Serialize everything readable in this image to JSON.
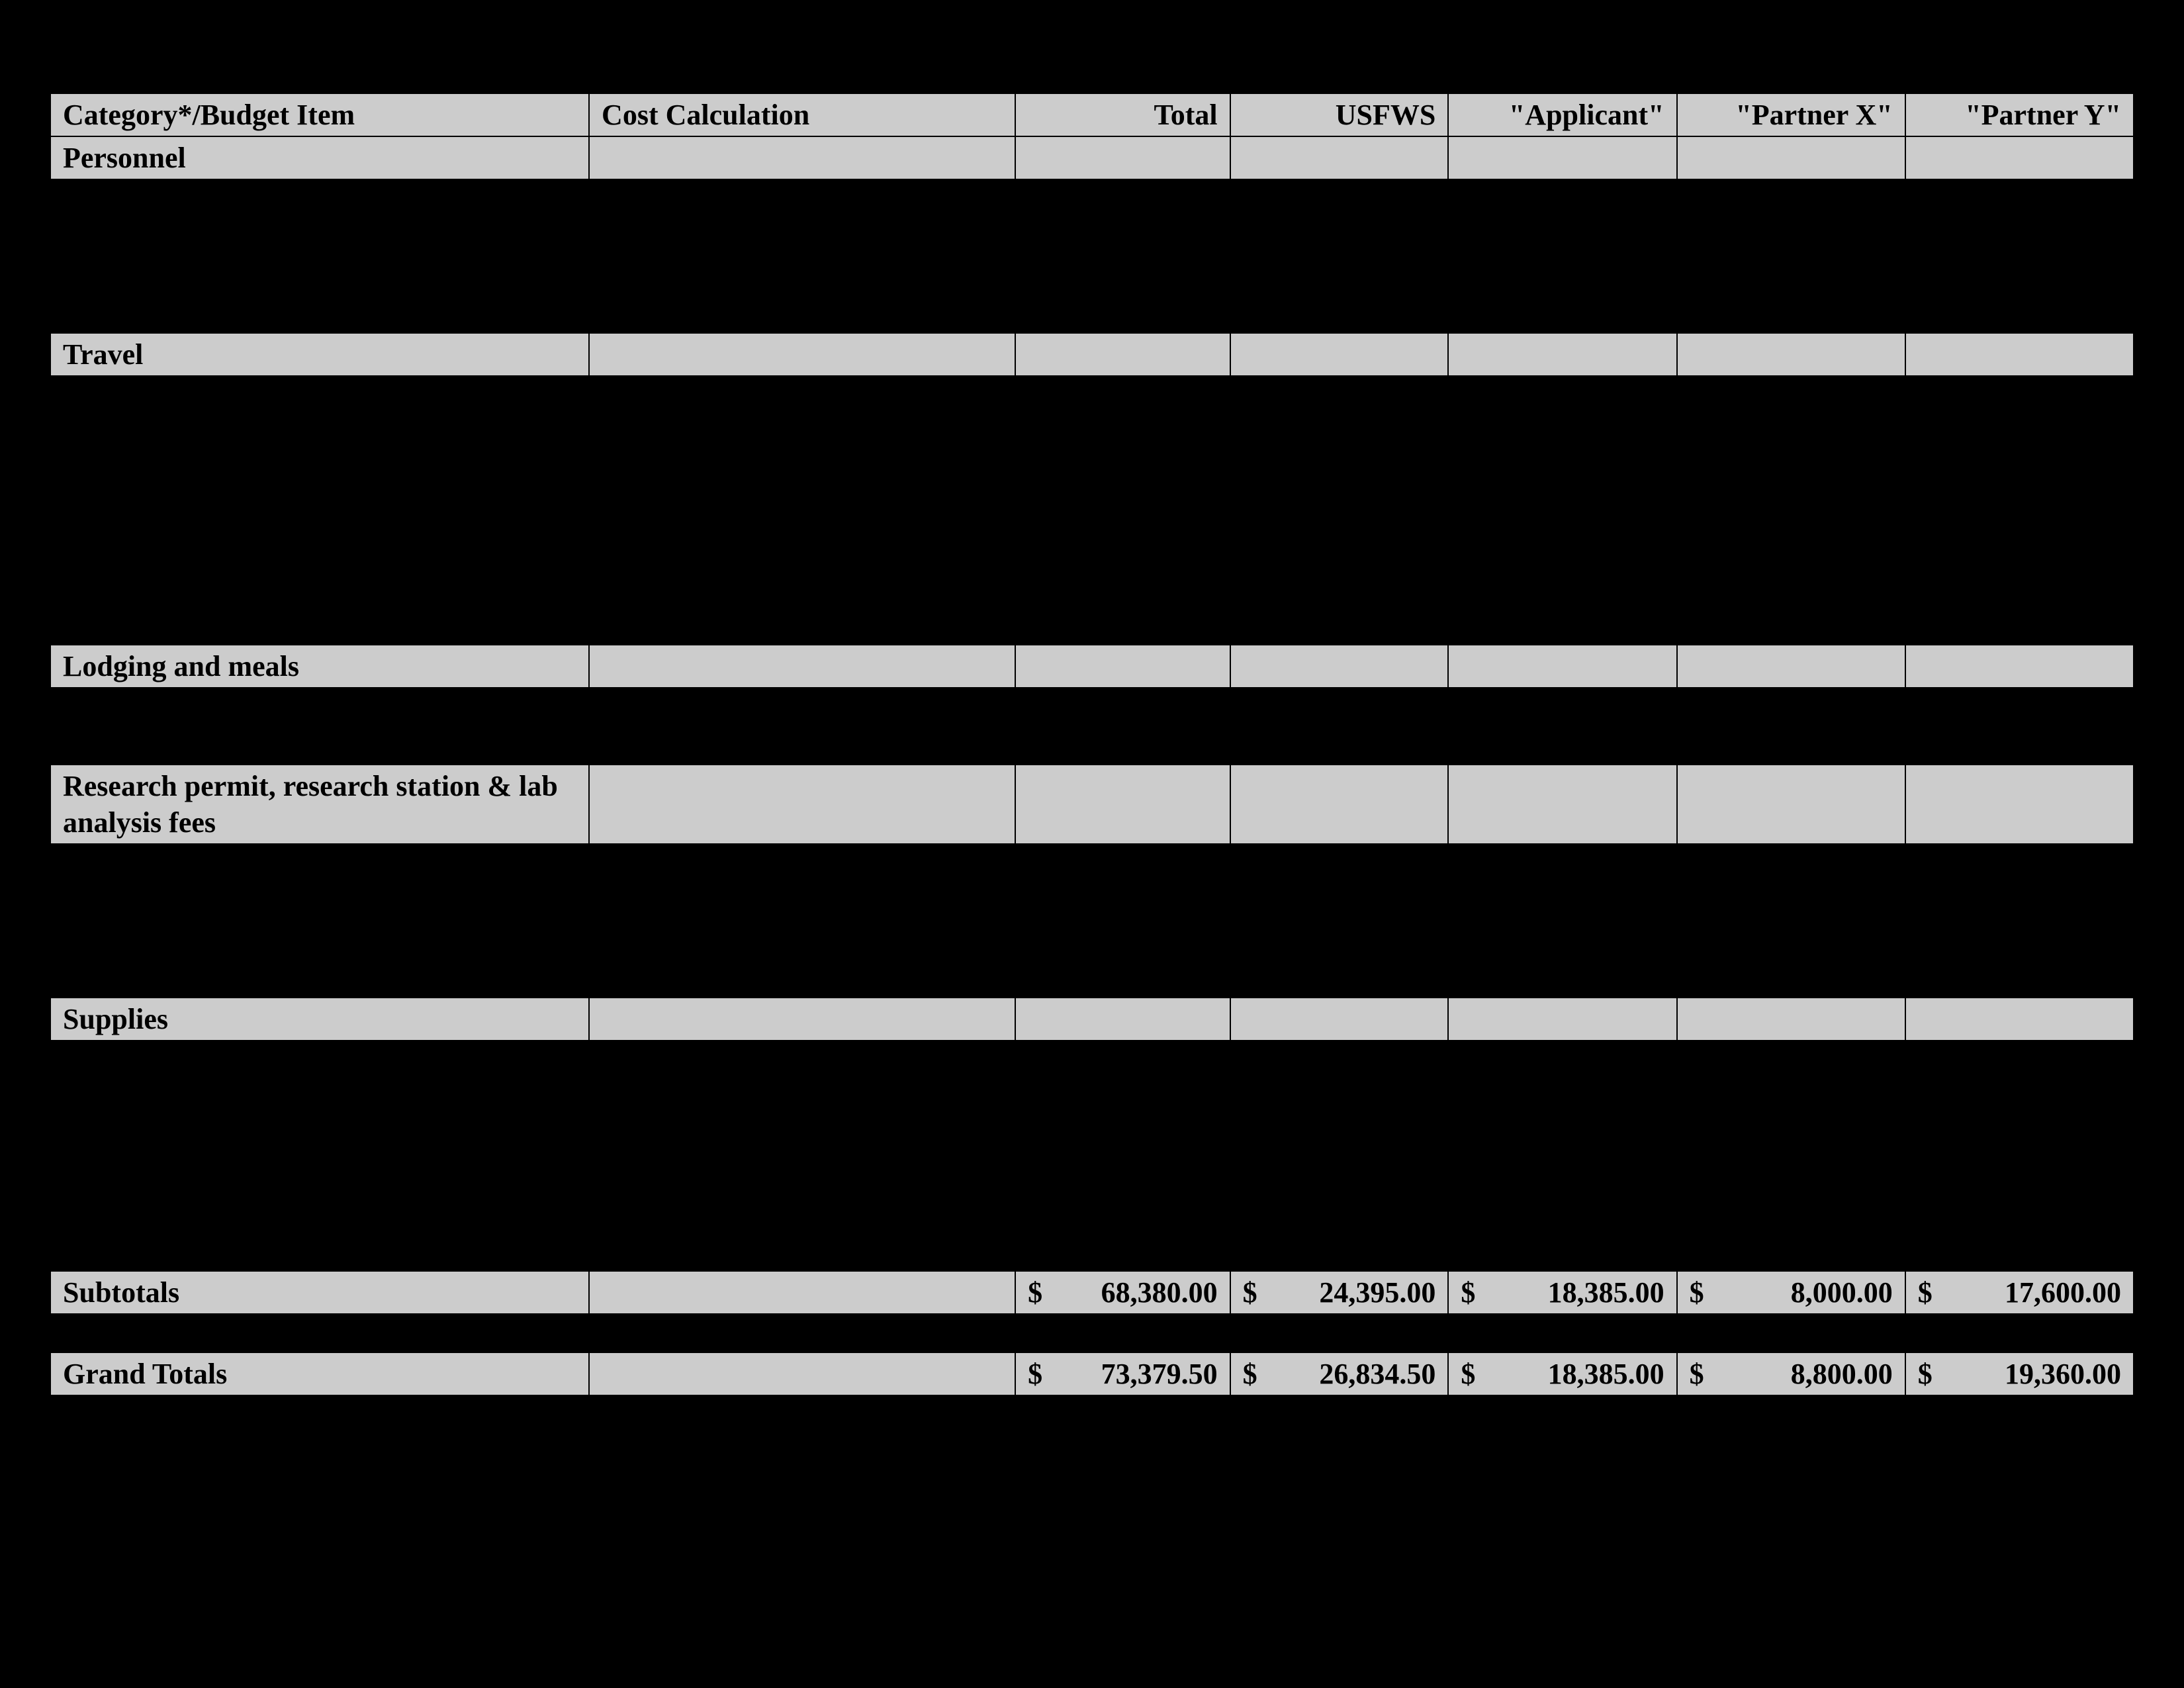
{
  "headers": {
    "category": "Category*/Budget Item",
    "calc": "Cost Calculation",
    "total": "Total",
    "usfws": "USFWS",
    "applicant": "\"Applicant\"",
    "partnerx": "\"Partner X\"",
    "partnery": "\"Partner Y\""
  },
  "sections": {
    "personnel": "Personnel",
    "travel": "Travel",
    "lodging": "Lodging and meals",
    "research": "Research permit, research station & lab analysis fees",
    "supplies": "Supplies"
  },
  "labels": {
    "subtotals": "Subtotals",
    "grandtotals": "Grand Totals"
  },
  "subtotals": {
    "total": "68,380.00",
    "usfws": "24,395.00",
    "applicant": "18,385.00",
    "partnerx": "8,000.00",
    "partnery": "17,600.00"
  },
  "grandtotals": {
    "total": "73,379.50",
    "usfws": "26,834.50",
    "applicant": "18,385.00",
    "partnerx": "8,800.00",
    "partnery": "19,360.00"
  },
  "currency": "$"
}
